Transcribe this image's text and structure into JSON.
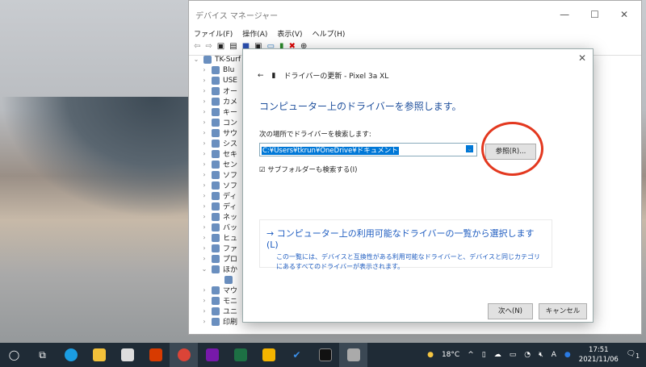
{
  "device_manager": {
    "title": "デバイス マネージャー",
    "menu": [
      "ファイル(F)",
      "操作(A)",
      "表示(V)",
      "ヘルプ(H)"
    ],
    "tree": [
      "TK-Surf",
      "Blu",
      "USE",
      "オー",
      "カメ",
      "キー",
      "コン",
      "サウ",
      "シス",
      "セキ",
      "セン",
      "ソフ",
      "ソフ",
      "ディ",
      "ディ",
      "ネッ",
      "バッ",
      "ヒュ",
      "ファ",
      "プロ",
      "ほか",
      "",
      "マウ",
      "モニ",
      "ユニ",
      "印刷"
    ]
  },
  "dialog": {
    "header": "ドライバーの更新 - Pixel 3a XL",
    "heading": "コンピューター上のドライバーを参照します。",
    "search_label": "次の場所でドライバーを検索します:",
    "path": "C:¥Users¥tkrun¥OneDrive¥ドキュメント",
    "browse": "参照(R)...",
    "subfolders": "サブフォルダーも検索する(I)",
    "option_title": "→ コンピューター上の利用可能なドライバーの一覧から選択します(L)",
    "option_desc": "この一覧には、デバイスと互換性がある利用可能なドライバーと、デバイスと同じカテゴリにあるすべてのドライバーが表示されます。",
    "next": "次へ(N)",
    "cancel": "キャンセル"
  },
  "taskbar": {
    "weather": "18°C",
    "time": "17:51",
    "date": "2021/11/06",
    "notifications": "1"
  },
  "colors": {
    "accent": "#0078d7",
    "highlight": "#e3381f"
  }
}
